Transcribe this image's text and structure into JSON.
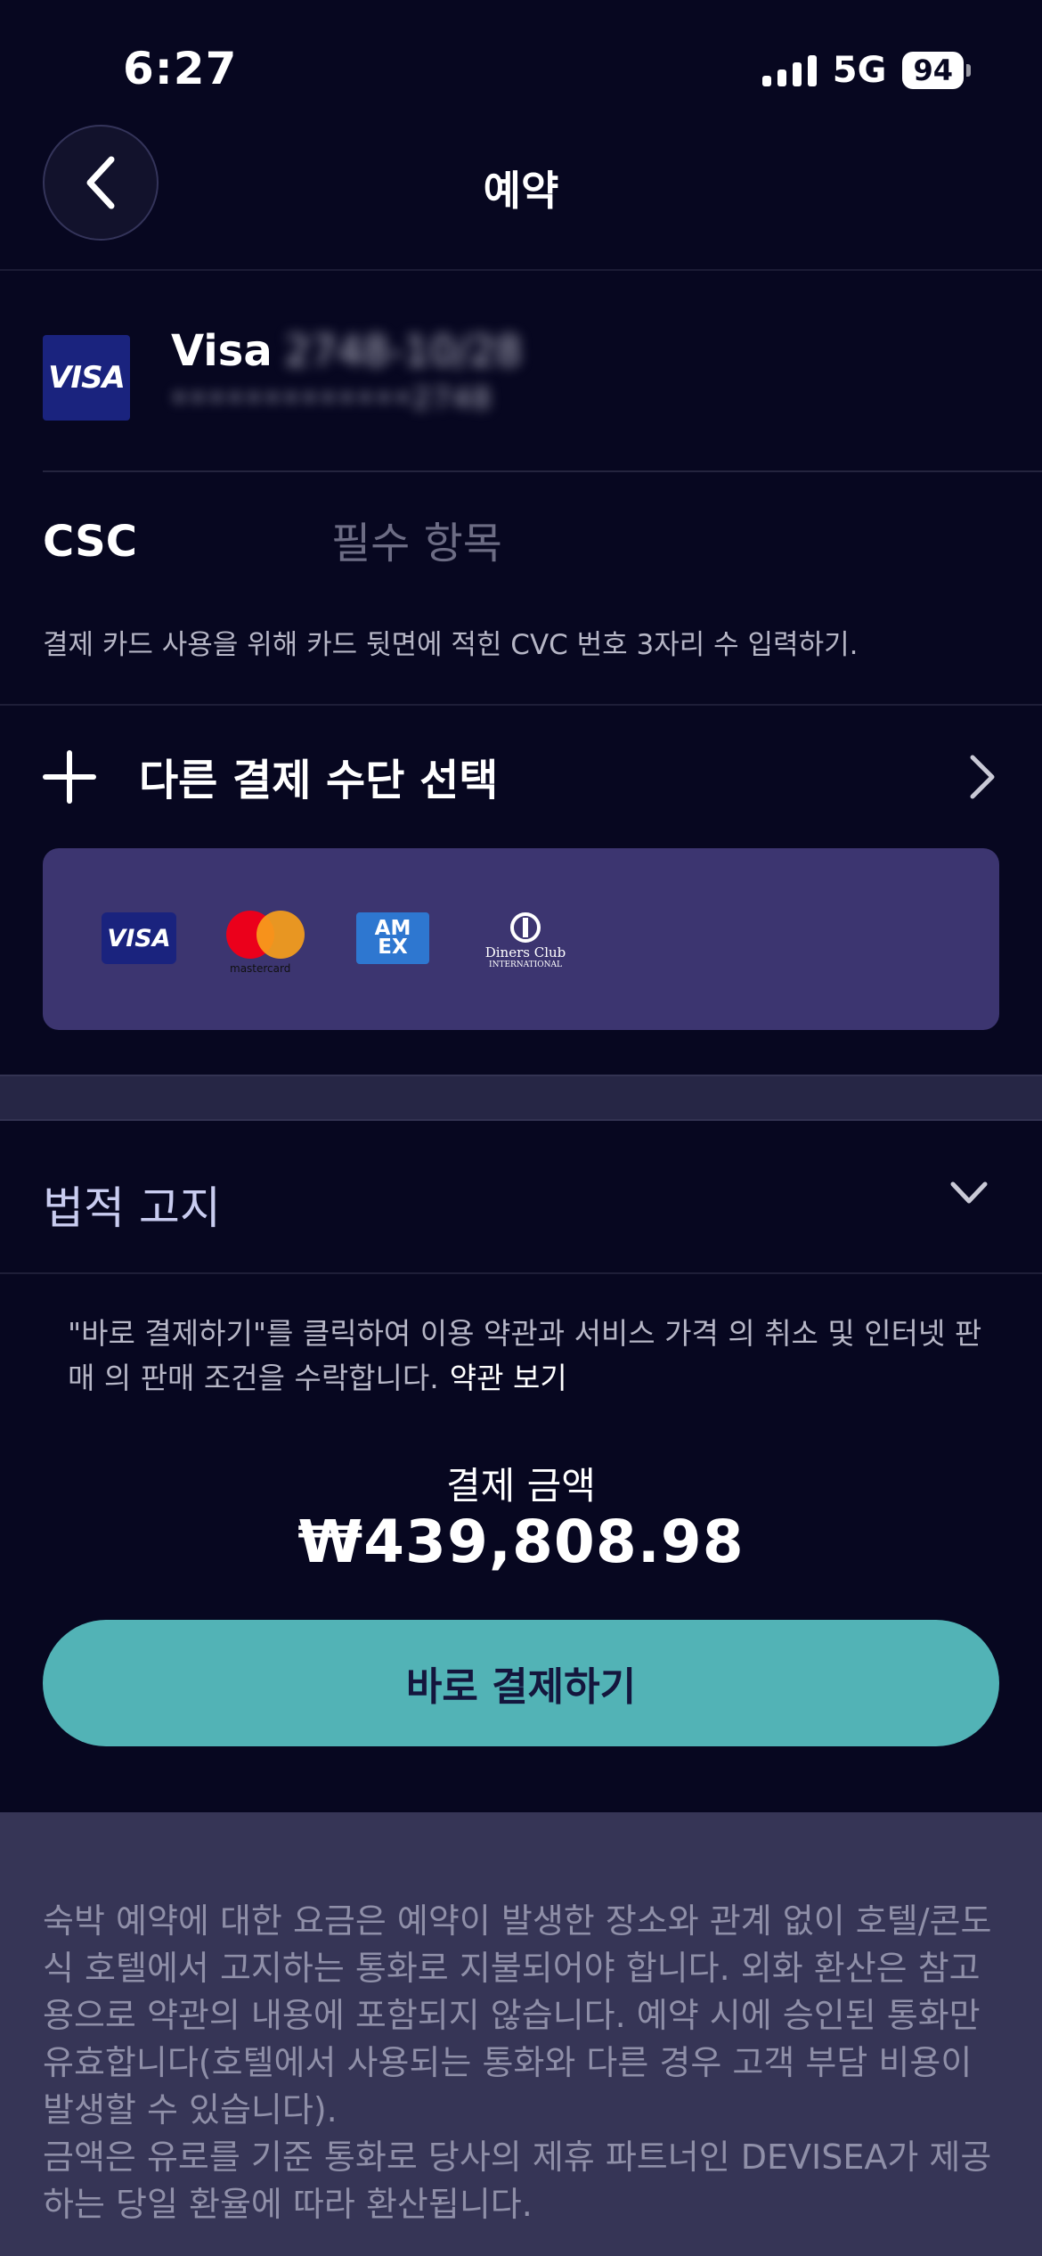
{
  "status_bar": {
    "time": "6:27",
    "network": "5G",
    "battery": "94"
  },
  "nav": {
    "title": "예약",
    "back_icon": "chevron-left-icon"
  },
  "card": {
    "brand_logo": "VISA",
    "brand": "Visa",
    "expiry": "2748-10/28",
    "masked_number": "•••••••••••••2748"
  },
  "csc": {
    "label": "CSC",
    "placeholder": "필수 항목",
    "hint": "결제 카드 사용을 위해 카드 뒷면에 적힌 CVC 번호 3자리 수 입력하기."
  },
  "other_payment": {
    "label": "다른 결제 수단 선택"
  },
  "accepted_cards": {
    "visa": "VISA",
    "mastercard": "mastercard",
    "amex_line1": "AM",
    "amex_line2": "EX",
    "diners": "Diners Club",
    "diners_sub": "INTERNATIONAL"
  },
  "legal": {
    "title": "법적 고지",
    "terms_text": "\"바로 결제하기\"를 클릭하여 이용 약관과 서비스 가격 의 취소 및 인터넷 판매 의 판매 조건을 수락합니다.",
    "terms_link": "약관 보기"
  },
  "payment": {
    "label": "결제 금액",
    "amount": "₩439,808.98",
    "button": "바로 결제하기"
  },
  "disclaimer": {
    "text": "숙박 예약에 대한 요금은 예약이 발생한 장소와 관계 없이 호텔/콘도식 호텔에서 고지하는 통화로 지불되어야 합니다. 외화 환산은 참고용으로 약관의 내용에 포함되지 않습니다. 예약 시에 승인된 통화만 유효합니다(호텔에서 사용되는 통화와 다른 경우 고객 부담 비용이 발생할 수 있습니다).",
    "text2": "금액은 유로를 기준 통화로 당사의 제휴 파트너인 DEVISEA가 제공하는 당일 환율에 따라 환산됩니다."
  }
}
